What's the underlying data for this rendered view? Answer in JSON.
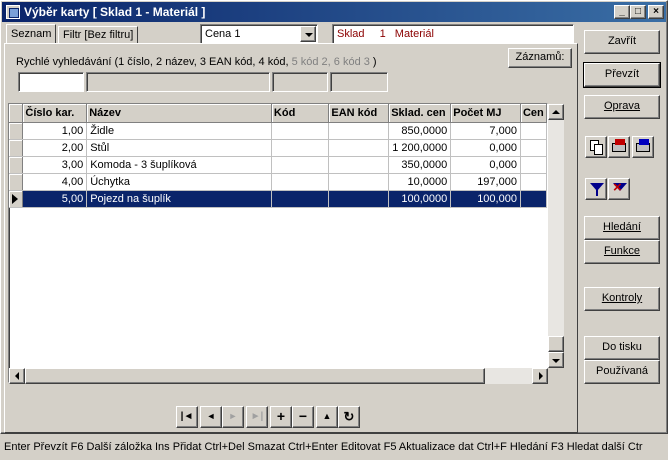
{
  "window": {
    "title": "Výběr karty [ Sklad 1 - Materiál ]",
    "minimize": "_",
    "maximize": "□",
    "close": "×"
  },
  "tabs": [
    {
      "label": "Seznam",
      "active": true
    },
    {
      "label": "Filtr [Bez filtru]",
      "active": false
    }
  ],
  "price_combo": {
    "value": "Cena 1"
  },
  "store_info": {
    "sklad": "Sklad",
    "number": "1",
    "name": "Materiál"
  },
  "quick_search": {
    "label_prefix": "Rychlé vyhledávání (",
    "opt1": "1 číslo, ",
    "opt2": "2 název, ",
    "opt3": "3 EAN kód, ",
    "opt4": "4 kód, ",
    "opt5": "5 kód 2, ",
    "opt6": "6 kód 3",
    "label_suffix": " )",
    "records_button": "Záznamů:"
  },
  "table": {
    "columns": [
      "Číslo kar.",
      "Název",
      "Kód",
      "EAN kód",
      "Sklad. cen",
      "Počet MJ",
      "Cen"
    ],
    "rows": [
      [
        "1,00",
        "Židle",
        "",
        "",
        "850,0000",
        "7,000",
        ""
      ],
      [
        "2,00",
        "Stůl",
        "",
        "",
        "1 200,0000",
        "0,000",
        ""
      ],
      [
        "3,00",
        "Komoda - 3 šuplíková",
        "",
        "",
        "350,0000",
        "0,000",
        ""
      ],
      [
        "4,00",
        "Úchytka",
        "",
        "",
        "10,0000",
        "197,000",
        ""
      ],
      [
        "5,00",
        "Pojezd na šuplík",
        "",
        "",
        "100,0000",
        "100,000",
        ""
      ]
    ],
    "selected_row": 4
  },
  "right_buttons": {
    "close": "Zavřít",
    "take": "Převzít",
    "edit": "Oprava",
    "search": "Hledání",
    "functions": "Funkce",
    "controls": "Kontroly",
    "to_print": "Do tisku",
    "used": "Používaná"
  },
  "nav": {
    "first": "|◄",
    "prev": "◄",
    "next": "►",
    "last": "►|",
    "add": "+",
    "delete": "−",
    "up": "▲",
    "refresh": "↻"
  },
  "status_bar": "Enter Převzít  F6 Další záložka  Ins Přidat  Ctrl+Del Smazat  Ctrl+Enter Editovat  F5 Aktualizace dat  Ctrl+F Hledání  F3 Hledat další  Ctr",
  "colors": {
    "title_start": "#0a246a",
    "title_end": "#3a6ea5",
    "selection": "#0a246a",
    "store_text": "#8b0000"
  }
}
